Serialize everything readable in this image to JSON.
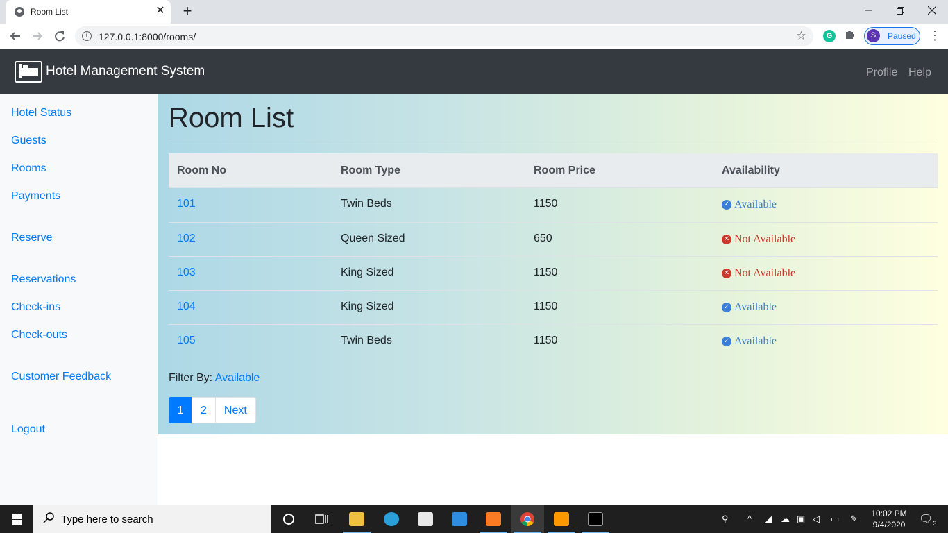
{
  "browser": {
    "tab_title": "Room List",
    "tab_close": "✕",
    "new_tab": "+",
    "url": "127.0.0.1:8000/rooms/",
    "profile_initial": "S",
    "profile_status": "Paused",
    "extension_letter": "G"
  },
  "navbar": {
    "brand": "Hotel Management System",
    "links": [
      "Profile",
      "Help"
    ]
  },
  "sidebar": {
    "items": [
      "Hotel Status",
      "Guests",
      "Rooms",
      "Payments",
      "Reserve",
      "Reservations",
      "Check-ins",
      "Check-outs",
      "Customer Feedback",
      "Logout"
    ]
  },
  "main": {
    "title": "Room List",
    "columns": [
      "Room No",
      "Room Type",
      "Room Price",
      "Availability"
    ],
    "rows": [
      {
        "no": "101",
        "type": "Twin Beds",
        "price": "1150",
        "status": "Available",
        "available": true
      },
      {
        "no": "102",
        "type": "Queen Sized",
        "price": "650",
        "status": "Not Available",
        "available": false
      },
      {
        "no": "103",
        "type": "King Sized",
        "price": "1150",
        "status": "Not Available",
        "available": false
      },
      {
        "no": "104",
        "type": "King Sized",
        "price": "1150",
        "status": "Available",
        "available": true
      },
      {
        "no": "105",
        "type": "Twin Beds",
        "price": "1150",
        "status": "Available",
        "available": true
      }
    ],
    "filter_label": "Filter By:",
    "filter_value": "Available",
    "pagination": [
      "1",
      "2",
      "Next"
    ],
    "current_page": "1"
  },
  "taskbar": {
    "search_placeholder": "Type here to search",
    "time": "10:02 PM",
    "date": "9/4/2020",
    "notification_count": "3"
  },
  "colors": {
    "link": "#007bff",
    "navbar": "#343a40",
    "available": "#3a7fd5",
    "not_available": "#c8392b"
  }
}
